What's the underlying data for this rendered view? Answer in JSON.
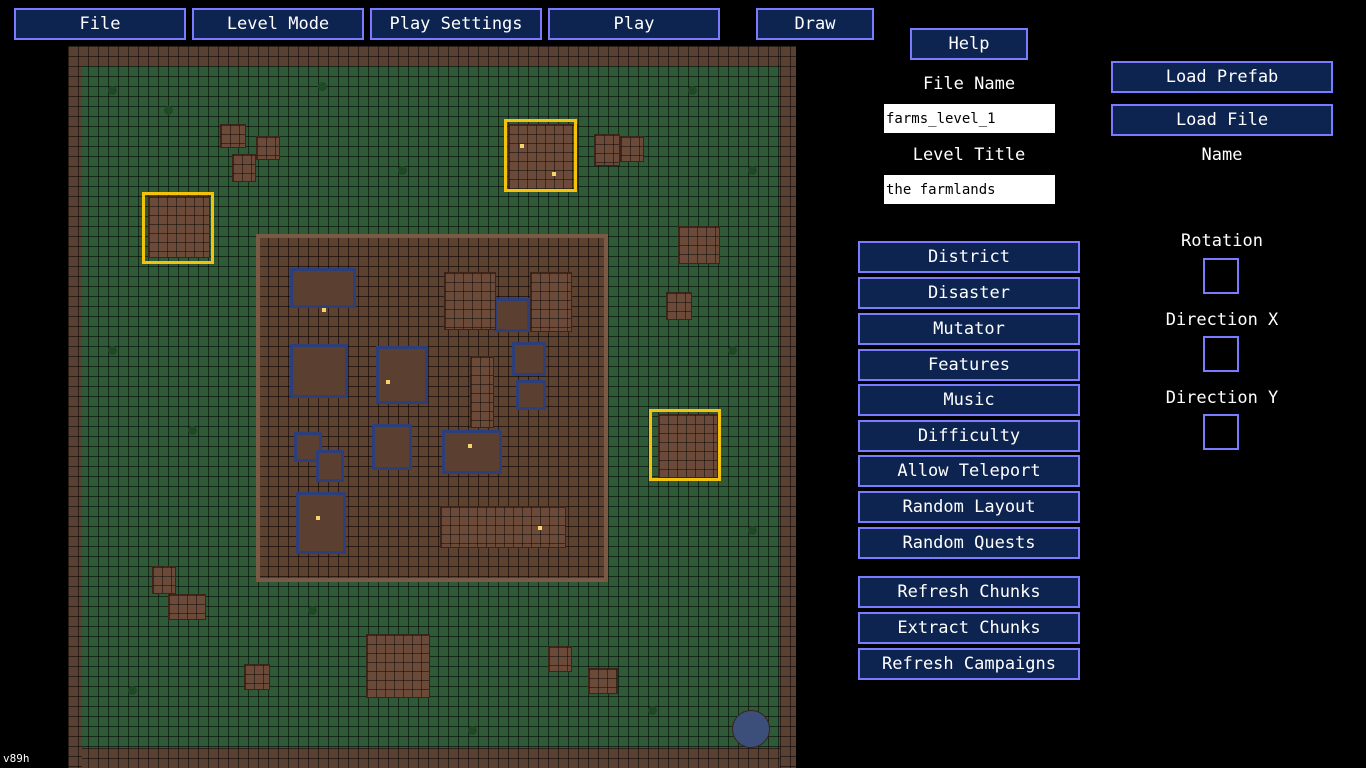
{
  "menu": {
    "file": "File",
    "level_mode": "Level Mode",
    "play_settings": "Play Settings",
    "play": "Play",
    "draw": "Draw"
  },
  "help": "Help",
  "file_name": {
    "label": "File Name",
    "value": "farms_level_1"
  },
  "level_title": {
    "label": "Level Title",
    "value": "the farmlands"
  },
  "options": [
    "District",
    "Disaster",
    "Mutator",
    "Features",
    "Music",
    "Difficulty",
    "Allow Teleport",
    "Random Layout",
    "Random Quests"
  ],
  "tools": [
    "Refresh Chunks",
    "Extract Chunks",
    "Refresh Campaigns"
  ],
  "prefab": {
    "load_prefab": "Load Prefab",
    "load_file": "Load File",
    "name_label": "Name",
    "rotation_label": "Rotation",
    "direction_x_label": "Direction X",
    "direction_y_label": "Direction Y"
  },
  "version": "v89h",
  "colors": {
    "button_bg": "#0d2450",
    "button_border": "#7b7bff",
    "selection": "#f2c20c",
    "grass": "#2f5a37"
  }
}
